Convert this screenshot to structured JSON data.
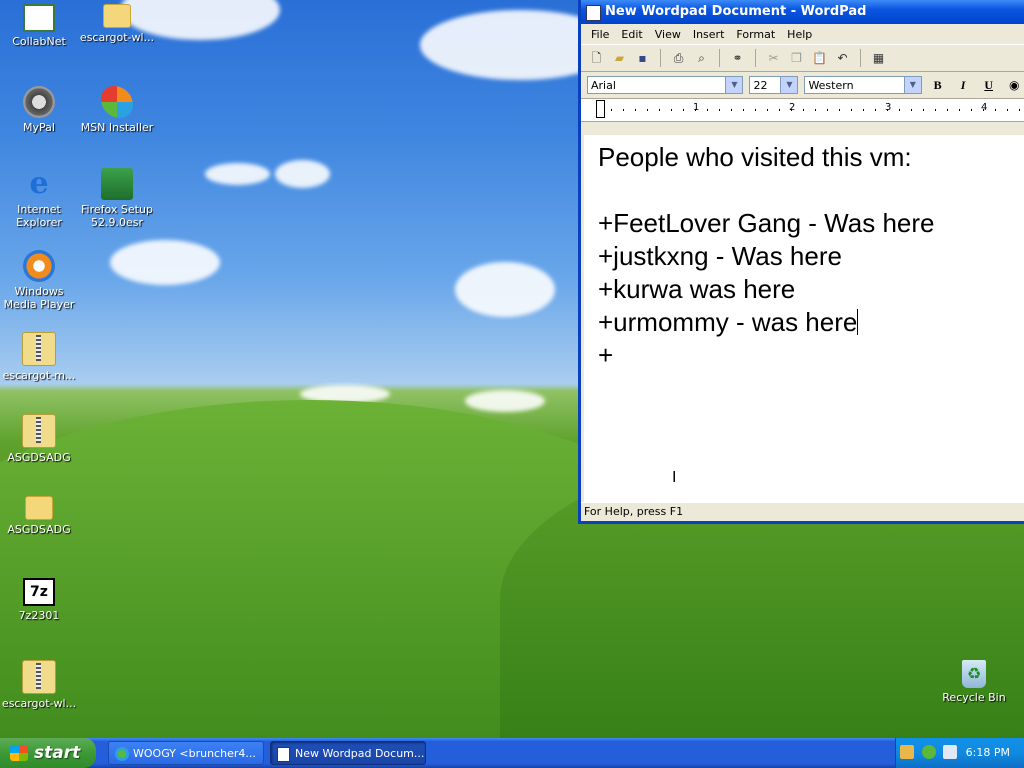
{
  "desktop": {
    "icons": [
      {
        "label": "CollabNet",
        "icon": "collabnet-icon"
      },
      {
        "label": "escargot-wl...",
        "icon": "folder-icon"
      },
      {
        "label": "MyPal",
        "icon": "mypal-raccoon-icon"
      },
      {
        "label": "MSN Installer",
        "icon": "msn-butterfly-icon"
      },
      {
        "label": "Internet Explorer",
        "icon": "internet-explorer-icon"
      },
      {
        "label": "Firefox Setup 52.9.0esr",
        "icon": "firefox-setup-icon"
      },
      {
        "label": "Windows Media Player",
        "icon": "windows-media-player-icon"
      },
      {
        "label": "escargot-m...",
        "icon": "zip-folder-icon"
      },
      {
        "label": "ASGDSADG",
        "icon": "zip-folder-icon"
      },
      {
        "label": "ASGDSADG",
        "icon": "folder-icon"
      },
      {
        "label": "7z2301",
        "icon": "7zip-icon"
      },
      {
        "label": "escargot-wl...",
        "icon": "zip-folder-icon"
      },
      {
        "label": "Recycle Bin",
        "icon": "recycle-bin-icon"
      }
    ]
  },
  "wordpad": {
    "title": "New Wordpad Document - WordPad",
    "menu": [
      "File",
      "Edit",
      "View",
      "Insert",
      "Format",
      "Help"
    ],
    "font_name": "Arial",
    "font_size": "22",
    "script": "Western",
    "bold_label": "B",
    "italic_label": "I",
    "underline_label": "U",
    "ruler_numbers": [
      "1",
      "2",
      "3",
      "4"
    ],
    "document_lines": [
      "People who visited this vm:",
      "",
      "+FeetLover Gang - Was here",
      "+justkxng - Was here",
      "+kurwa was here",
      "+urmommy - was here",
      "+"
    ],
    "status": "For Help, press F1"
  },
  "taskbar": {
    "start_label": "start",
    "tasks": [
      {
        "label": "WOOGY <bruncher4...",
        "icon": "messenger-icon"
      },
      {
        "label": "New Wordpad Docum...",
        "icon": "wordpad-icon"
      }
    ],
    "clock": "6:18 PM"
  },
  "colors": {
    "titlebar": "#0a55e0",
    "taskbar": "#245edb",
    "start_button": "#3c9a36",
    "tray": "#0f8ae0"
  }
}
